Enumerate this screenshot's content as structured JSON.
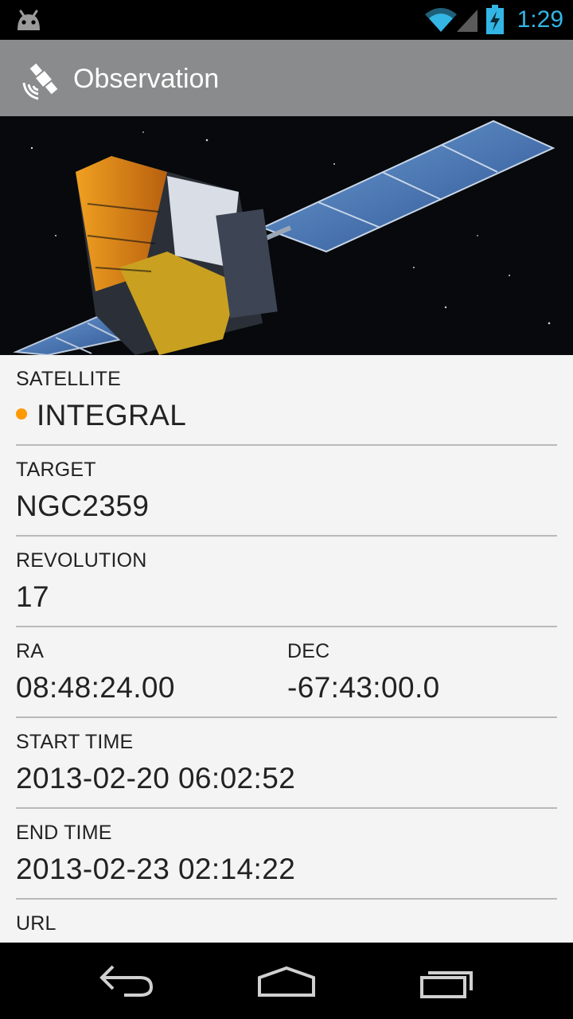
{
  "status_bar": {
    "time": "1:29",
    "icons": [
      "android-icon",
      "wifi-icon",
      "signal-icon",
      "battery-charging-icon"
    ],
    "accent_color": "#33b5e5"
  },
  "action_bar": {
    "title": "Observation",
    "icon": "satellite-icon",
    "background": "#8a8b8c"
  },
  "hero_image": {
    "subject": "satellite-image"
  },
  "details": {
    "satellite": {
      "label": "SATELLITE",
      "value": "INTEGRAL",
      "status_color": "#ff9900"
    },
    "target": {
      "label": "TARGET",
      "value": "NGC2359"
    },
    "revolution": {
      "label": "REVOLUTION",
      "value": "17"
    },
    "ra": {
      "label": "RA",
      "value": "08:48:24.00"
    },
    "dec": {
      "label": "DEC",
      "value": "-67:43:00.0"
    },
    "start_time": {
      "label": "START TIME",
      "value": "2013-02-20 06:02:52"
    },
    "end_time": {
      "label": "END TIME",
      "value": "2013-02-23 02:14:22"
    },
    "url": {
      "label": "URL"
    }
  },
  "nav_bar": {
    "buttons": [
      "back-icon",
      "home-icon",
      "recent-apps-icon"
    ]
  }
}
